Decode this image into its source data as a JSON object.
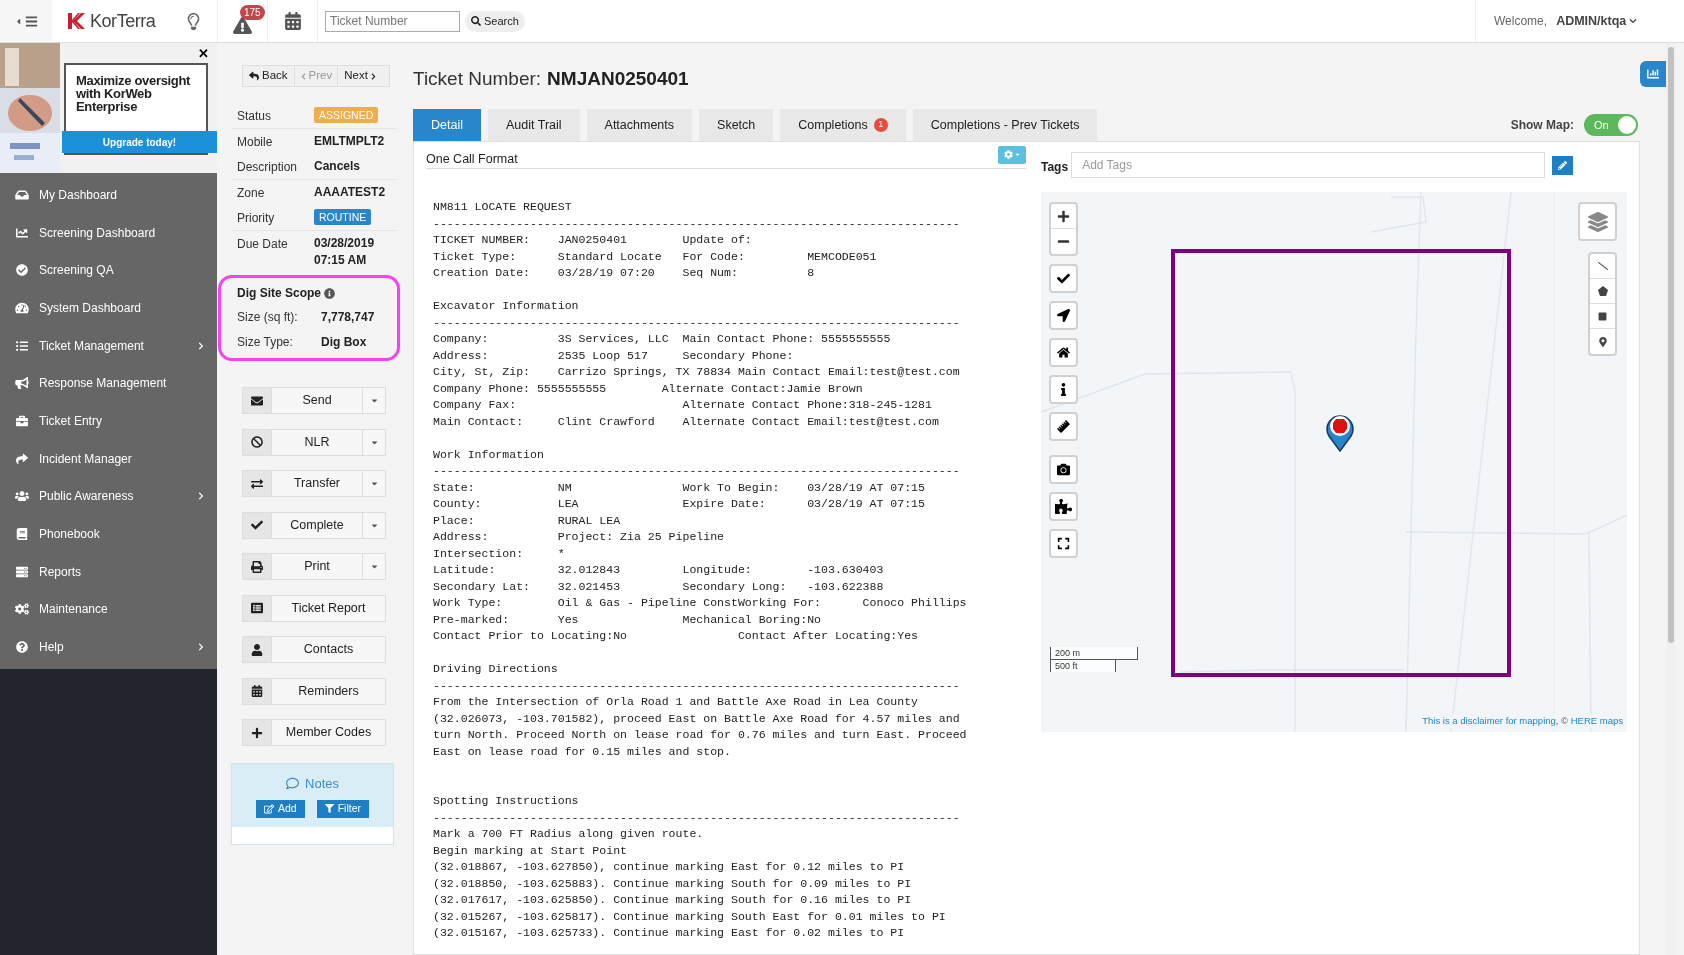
{
  "topbar": {
    "logo": "KorTerra",
    "alert_count": "175",
    "ticket_field": {
      "placeholder": "Ticket Number"
    },
    "search_button": "Search",
    "welcome": "Welcome,",
    "user": "ADMIN/ktqa"
  },
  "promo": {
    "headline": "Maximize oversight with KorWeb Enterprise",
    "button": "Upgrade today!",
    "close": "✕"
  },
  "sidebar": {
    "items": [
      {
        "label": "My Dashboard",
        "has_submenu": false
      },
      {
        "label": "Screening Dashboard",
        "has_submenu": false
      },
      {
        "label": "Screening QA",
        "has_submenu": false
      },
      {
        "label": "System Dashboard",
        "has_submenu": false
      },
      {
        "label": "Ticket Management",
        "has_submenu": true
      },
      {
        "label": "Response Management",
        "has_submenu": false
      },
      {
        "label": "Ticket Entry",
        "has_submenu": false
      },
      {
        "label": "Incident Manager",
        "has_submenu": false
      },
      {
        "label": "Public Awareness",
        "has_submenu": true
      },
      {
        "label": "Phonebook",
        "has_submenu": false
      },
      {
        "label": "Reports",
        "has_submenu": false
      },
      {
        "label": "Maintenance",
        "has_submenu": false
      },
      {
        "label": "Help",
        "has_submenu": true
      }
    ]
  },
  "nav": {
    "back": "Back",
    "prev": "Prev",
    "next": "Next",
    "prev_disabled": true
  },
  "ticket_fields": [
    {
      "label": "Status",
      "value": "ASSIGNED",
      "kind": "badge",
      "color": "#f0ad4e"
    },
    {
      "label": "Mobile",
      "value": "EMLTMPLT2",
      "kind": "text"
    },
    {
      "label": "Description",
      "value": "Cancels",
      "kind": "text"
    },
    {
      "label": "Zone",
      "value": "AAAATEST2",
      "kind": "text"
    },
    {
      "label": "Priority",
      "value": "ROUTINE",
      "kind": "badge",
      "color": "#2a86ca"
    },
    {
      "label": "Due Date",
      "value": "03/28/2019 07:15 AM",
      "kind": "text"
    }
  ],
  "dig_site": {
    "title": "Dig Site Scope",
    "rows": [
      {
        "label": "Size (sq ft):",
        "value": "7,778,747"
      },
      {
        "label": "Size Type:",
        "value": "Dig Box"
      }
    ]
  },
  "actions": [
    {
      "label": "Send",
      "dropdown": true
    },
    {
      "label": "NLR",
      "dropdown": true
    },
    {
      "label": "Transfer",
      "dropdown": true
    },
    {
      "label": "Complete",
      "dropdown": true
    },
    {
      "label": "Print",
      "dropdown": true
    },
    {
      "label": "Ticket Report",
      "dropdown": false
    },
    {
      "label": "Contacts",
      "dropdown": false
    },
    {
      "label": "Reminders",
      "dropdown": false
    },
    {
      "label": "Member Codes",
      "dropdown": false
    }
  ],
  "notes": {
    "title": "Notes",
    "add": "Add",
    "filter": "Filter"
  },
  "ticket_title": {
    "label": "Ticket Number:",
    "number": "NMJAN0250401"
  },
  "tabs": [
    {
      "label": "Detail",
      "selected": true
    },
    {
      "label": "Audit Trail",
      "selected": false
    },
    {
      "label": "Attachments",
      "selected": false
    },
    {
      "label": "Sketch",
      "selected": false
    },
    {
      "label": "Completions",
      "selected": false,
      "badge": "1"
    },
    {
      "label": "Completions - Prev Tickets",
      "selected": false
    }
  ],
  "show_map": {
    "label": "Show Map:",
    "on": true,
    "text": "On"
  },
  "one_call": {
    "title": "One Call Format",
    "sections": [
      {
        "heading": "NM811 LOCATE REQUEST",
        "rule": "----------------------------------------------------------------------------",
        "extra_gap": false,
        "lines": [
          "TICKET NUMBER:    JAN0250401        Update of:",
          "Ticket Type:      Standard Locate   For Code:         MEMCODE051",
          "Creation Date:    03/28/19 07:20    Seq Num:          8"
        ]
      },
      {
        "heading": "Excavator Information",
        "rule": "----------------------------------------------------------------------------",
        "extra_gap": false,
        "lines": [
          "Company:          3S Services, LLC  Main Contact Phone: 5555555555",
          "Address:          2535 Loop 517     Secondary Phone:",
          "City, St, Zip:    Carrizo Springs, TX 78834 Main Contact Email:test@test.com",
          "Company Phone: 5555555555        Alternate Contact:Jamie Brown",
          "Company Fax:                        Alternate Contact Phone:318-245-1281",
          "Main Contact:     Clint Crawford    Alternate Contact Email:test@test.com"
        ]
      },
      {
        "heading": "Work Information",
        "rule": "----------------------------------------------------------------------------",
        "extra_gap": false,
        "lines": [
          "State:            NM                Work To Begin:    03/28/19 AT 07:15",
          "County:           LEA               Expire Date:      03/28/19 AT 07:15",
          "Place:            RURAL LEA",
          "Address:          Project: Zia 25 Pipeline",
          "Intersection:     *",
          "Latitude:         32.012843         Longitude:        -103.630403",
          "Secondary Lat:    32.021453         Secondary Long:   -103.622388",
          "Work Type:        Oil & Gas - Pipeline ConstWorking For:      Conoco Phillips",
          "Pre-marked:       Yes               Mechanical Boring:No",
          "Contact Prior to Locating:No                Contact After Locating:Yes"
        ]
      },
      {
        "heading": "Driving Directions",
        "rule": "----------------------------------------------------------------------------",
        "extra_gap": true,
        "lines": [
          "From the Intersection of Orla Road 1 and Battle Axe Road in Lea County",
          "(32.026073, -103.701582), proceed East on Battle Axe Road for 4.57 miles and",
          "turn North. Proceed North on lease road for 0.76 miles and turn East. Proceed",
          "East on lease road for 0.15 miles and stop."
        ]
      },
      {
        "heading": "Spotting Instructions",
        "rule": "----------------------------------------------------------------------------",
        "extra_gap": false,
        "lines": [
          "Mark a 700 FT Radius along given route.",
          "Begin marking at Start Point",
          "(32.018867, -103.627850), continue marking East for 0.12 miles to PI",
          "(32.018850, -103.625883). Continue marking South for 0.09 miles to PI",
          "(32.017617, -103.625850). Continue marking South for 0.16 miles to PI",
          "(32.015267, -103.625817). Continue marking South East for 0.01 miles to PI",
          "(32.015167, -103.625733). Continue marking East for 0.02 miles to PI"
        ]
      }
    ]
  },
  "tags": {
    "label": "Tags",
    "placeholder": "Add Tags"
  },
  "map": {
    "scale": [
      "200 m",
      "500 ft"
    ],
    "disclaimer": "This is a disclaimer for mapping",
    "separator": ", ©",
    "attribution": "HERE maps"
  }
}
